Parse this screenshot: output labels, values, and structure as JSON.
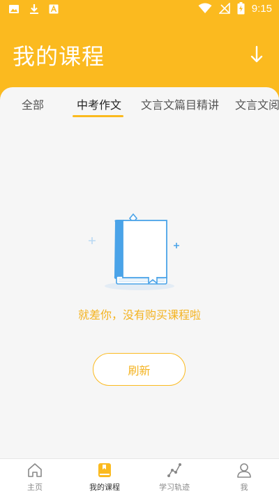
{
  "status_bar": {
    "time": "9:15",
    "left_icons": [
      "image-icon",
      "download-icon",
      "a-icon"
    ],
    "right_icons": [
      "wifi-icon",
      "no-signal-icon",
      "battery-charging-icon"
    ]
  },
  "header": {
    "title": "我的课程",
    "action_icon": "arrow-down-icon"
  },
  "tabs": [
    {
      "label": "全部",
      "active": false
    },
    {
      "label": "中考作文",
      "active": true
    },
    {
      "label": "文言文篇目精讲",
      "active": false
    },
    {
      "label": "文言文阅",
      "active": false
    }
  ],
  "empty_state": {
    "illustration": "book-icon",
    "message": "就差你，没有购买课程啦",
    "refresh_label": "刷新"
  },
  "bottom_nav": [
    {
      "label": "主页",
      "icon": "home-icon",
      "active": false
    },
    {
      "label": "我的课程",
      "icon": "course-book-icon",
      "active": true
    },
    {
      "label": "学习轨迹",
      "icon": "trajectory-icon",
      "active": false
    },
    {
      "label": "我",
      "icon": "profile-icon",
      "active": false
    }
  ],
  "colors": {
    "accent": "#fbba1f",
    "accent_text": "#f4b320",
    "illustration_blue": "#4aa3e8"
  }
}
